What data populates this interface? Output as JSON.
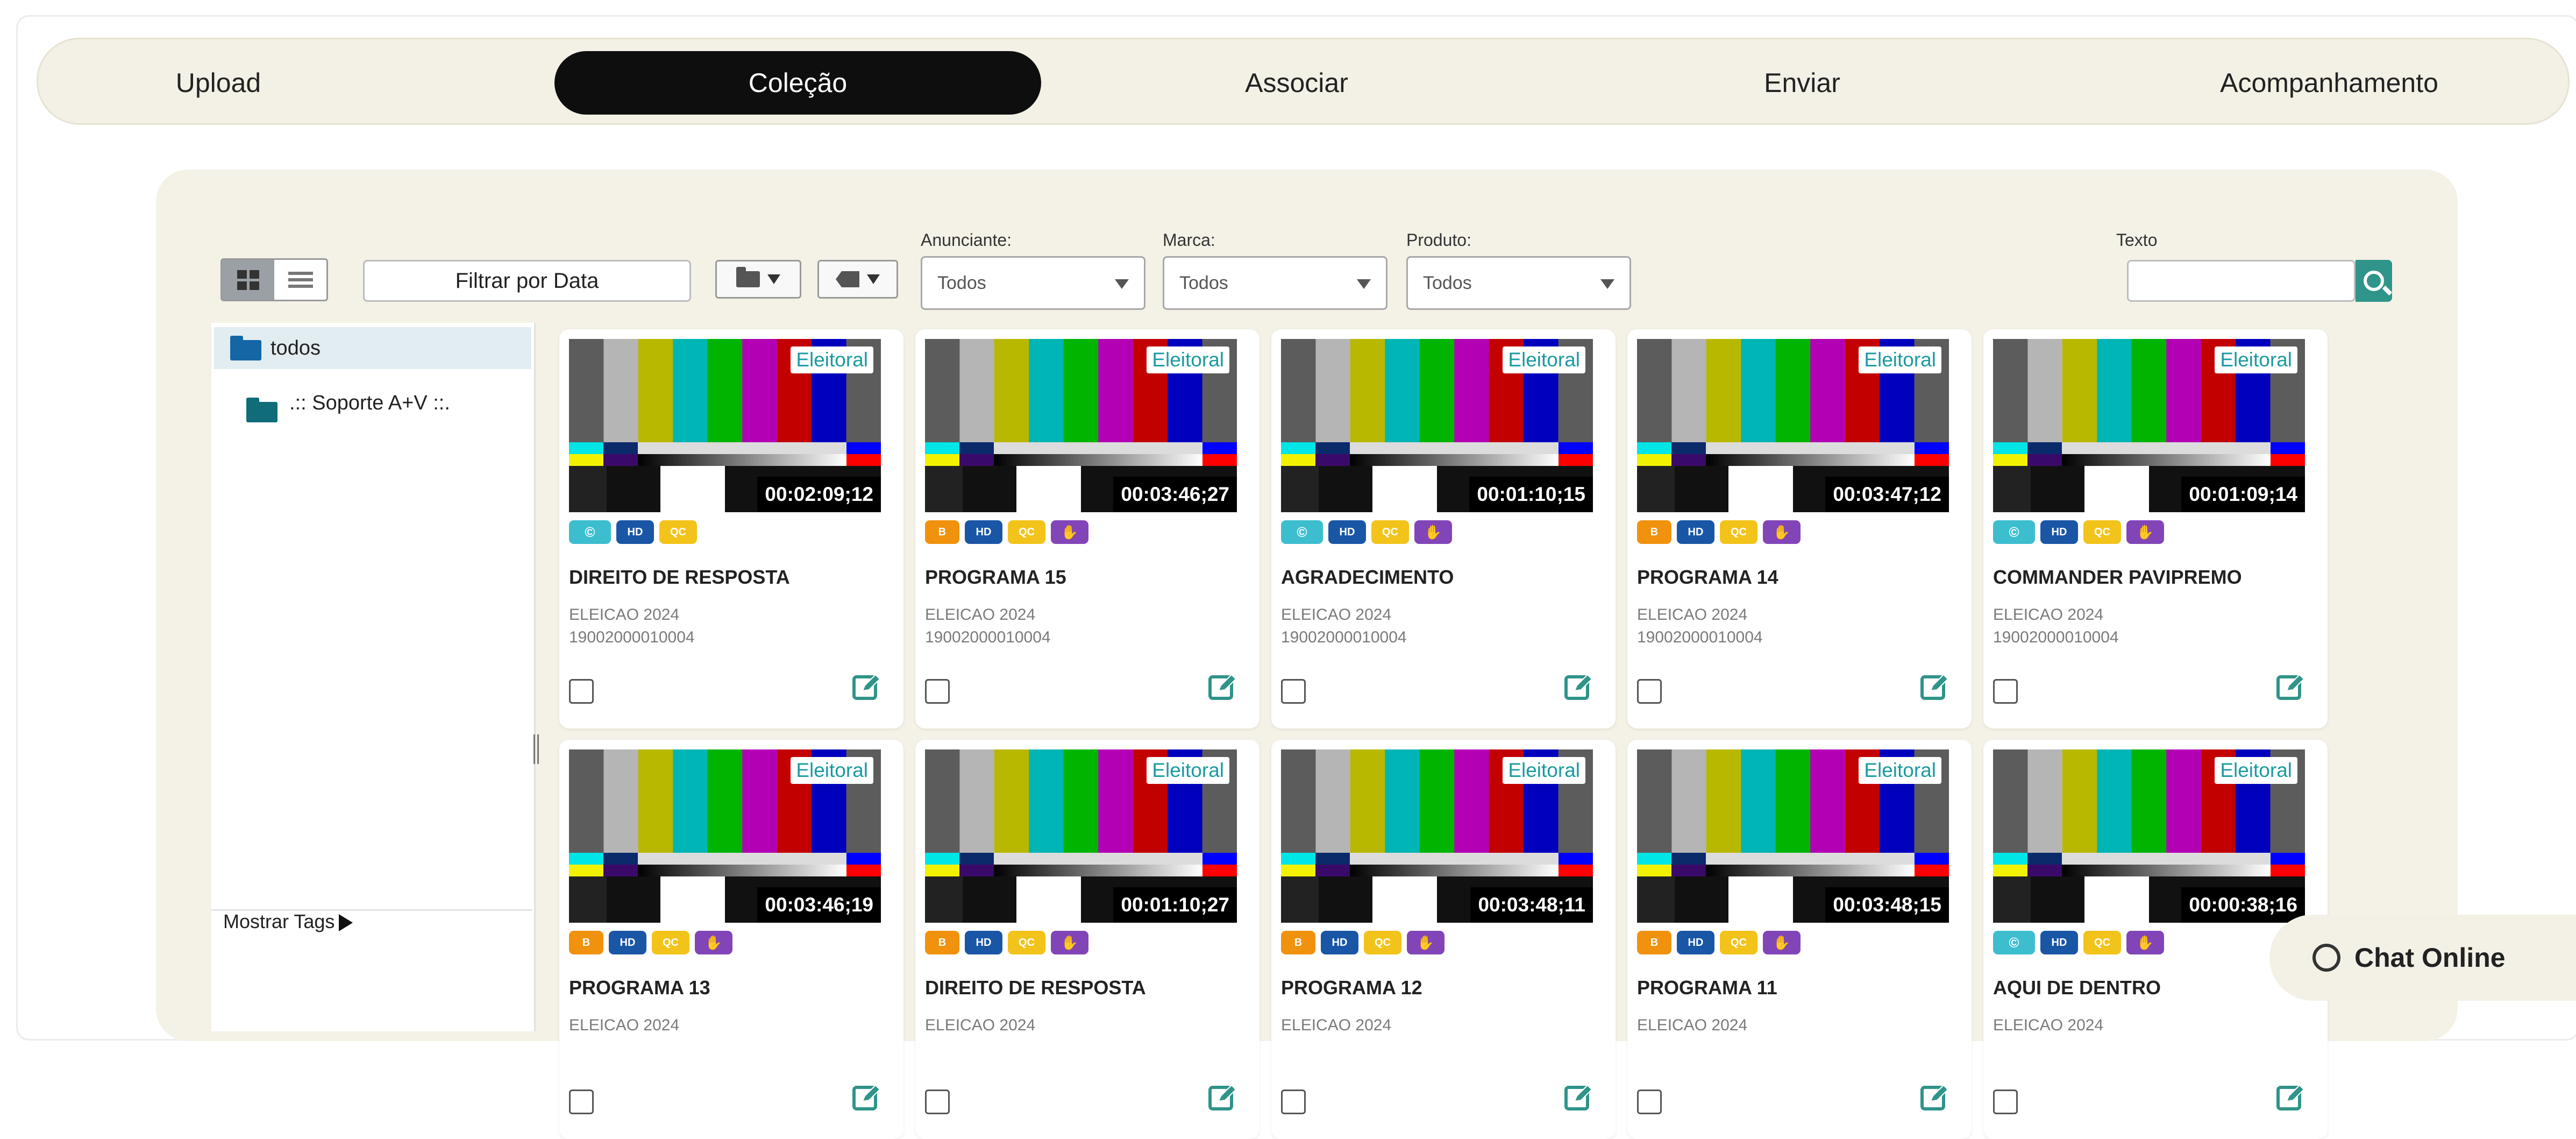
{
  "tabs": [
    {
      "label": "Upload",
      "active": false
    },
    {
      "label": "Coleção",
      "active": true
    },
    {
      "label": "Associar",
      "active": false
    },
    {
      "label": "Enviar",
      "active": false
    },
    {
      "label": "Acompanhamento",
      "active": false
    }
  ],
  "toolbar": {
    "date_filter": "Filtrar por Data",
    "filters": [
      {
        "label": "Anunciante:",
        "value": "Todos"
      },
      {
        "label": "Marca:",
        "value": "Todos"
      },
      {
        "label": "Produto:",
        "value": "Todos"
      }
    ],
    "text_label": "Texto",
    "text_value": ""
  },
  "sidebar": {
    "root": "todos",
    "sub": ".:: Soporte A+V ::.",
    "show_tags": "Mostrar Tags"
  },
  "cards": [
    {
      "tag": "Eleitoral",
      "duration": "00:02:09;12",
      "badges": [
        "cc",
        "hd",
        "qc"
      ],
      "title": "DIREITO DE RESPOSTA",
      "line1": "ELEICAO 2024",
      "line2": "19002000010004"
    },
    {
      "tag": "Eleitoral",
      "duration": "00:03:46;27",
      "badges": [
        "b",
        "hd",
        "qc",
        "hand"
      ],
      "title": "PROGRAMA 15",
      "line1": "ELEICAO 2024",
      "line2": "19002000010004"
    },
    {
      "tag": "Eleitoral",
      "duration": "00:01:10;15",
      "badges": [
        "cc",
        "hd",
        "qc",
        "hand"
      ],
      "title": "AGRADECIMENTO",
      "line1": "ELEICAO 2024",
      "line2": "19002000010004"
    },
    {
      "tag": "Eleitoral",
      "duration": "00:03:47;12",
      "badges": [
        "b",
        "hd",
        "qc",
        "hand"
      ],
      "title": "PROGRAMA 14",
      "line1": "ELEICAO 2024",
      "line2": "19002000010004"
    },
    {
      "tag": "Eleitoral",
      "duration": "00:01:09;14",
      "badges": [
        "cc",
        "hd",
        "qc",
        "hand"
      ],
      "title": "COMMANDER PAVIPREMO",
      "line1": "ELEICAO 2024",
      "line2": "19002000010004"
    },
    {
      "tag": "Eleitoral",
      "duration": "00:03:46;19",
      "badges": [
        "b",
        "hd",
        "qc",
        "hand"
      ],
      "title": "PROGRAMA 13",
      "line1": "ELEICAO 2024",
      "line2": ""
    },
    {
      "tag": "Eleitoral",
      "duration": "00:01:10;27",
      "badges": [
        "b",
        "hd",
        "qc",
        "hand"
      ],
      "title": "DIREITO DE RESPOSTA",
      "line1": "ELEICAO 2024",
      "line2": ""
    },
    {
      "tag": "Eleitoral",
      "duration": "00:03:48;11",
      "badges": [
        "b",
        "hd",
        "qc",
        "hand"
      ],
      "title": "PROGRAMA 12",
      "line1": "ELEICAO 2024",
      "line2": ""
    },
    {
      "tag": "Eleitoral",
      "duration": "00:03:48;15",
      "badges": [
        "b",
        "hd",
        "qc",
        "hand"
      ],
      "title": "PROGRAMA 11",
      "line1": "ELEICAO 2024",
      "line2": ""
    },
    {
      "tag": "Eleitoral",
      "duration": "00:00:38;16",
      "badges": [
        "cc",
        "hd",
        "qc",
        "hand"
      ],
      "title": "AQUI DE DENTRO",
      "line1": "ELEICAO 2024",
      "line2": ""
    }
  ],
  "badge_text": {
    "b": "B",
    "hd": "HD",
    "qc": "QC",
    "cc": "",
    "hand": ""
  },
  "chat": {
    "label": "Chat Online"
  },
  "colors": {
    "accent": "#2f9489",
    "tag_text": "#1a9aa0",
    "active_tab": "#0e0e0e"
  }
}
